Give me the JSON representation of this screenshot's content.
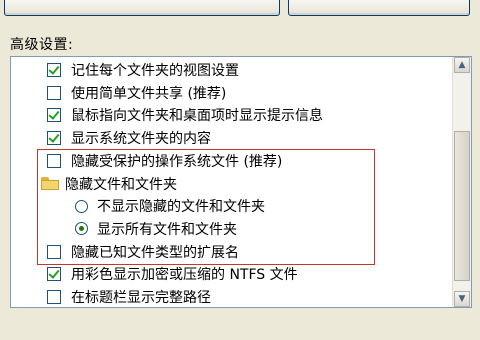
{
  "section_label": "高级设置:",
  "items": [
    {
      "type": "checkbox",
      "checked": true,
      "label": "记住每个文件夹的视图设置"
    },
    {
      "type": "checkbox",
      "checked": false,
      "label": "使用简单文件共享 (推荐)"
    },
    {
      "type": "checkbox",
      "checked": true,
      "label": "鼠标指向文件夹和桌面项时显示提示信息"
    },
    {
      "type": "checkbox",
      "checked": true,
      "label": "显示系统文件夹的内容"
    },
    {
      "type": "checkbox",
      "checked": false,
      "label": "隐藏受保护的操作系统文件 (推荐)"
    },
    {
      "type": "folder",
      "label": "隐藏文件和文件夹"
    },
    {
      "type": "radio",
      "checked": false,
      "label": "不显示隐藏的文件和文件夹"
    },
    {
      "type": "radio",
      "checked": true,
      "label": "显示所有文件和文件夹"
    },
    {
      "type": "checkbox",
      "checked": false,
      "label": "隐藏已知文件类型的扩展名"
    },
    {
      "type": "checkbox",
      "checked": true,
      "label": "用彩色显示加密或压缩的 NTFS 文件"
    },
    {
      "type": "checkbox",
      "checked": false,
      "label": "在标题栏显示完整路径"
    }
  ],
  "colors": {
    "highlight_border": "#c0392b",
    "check_mark": "#21a121"
  },
  "icons": {
    "folder": "folder-icon",
    "scroll_up": "scroll-up-arrow-icon",
    "scroll_down": "scroll-down-arrow-icon"
  }
}
